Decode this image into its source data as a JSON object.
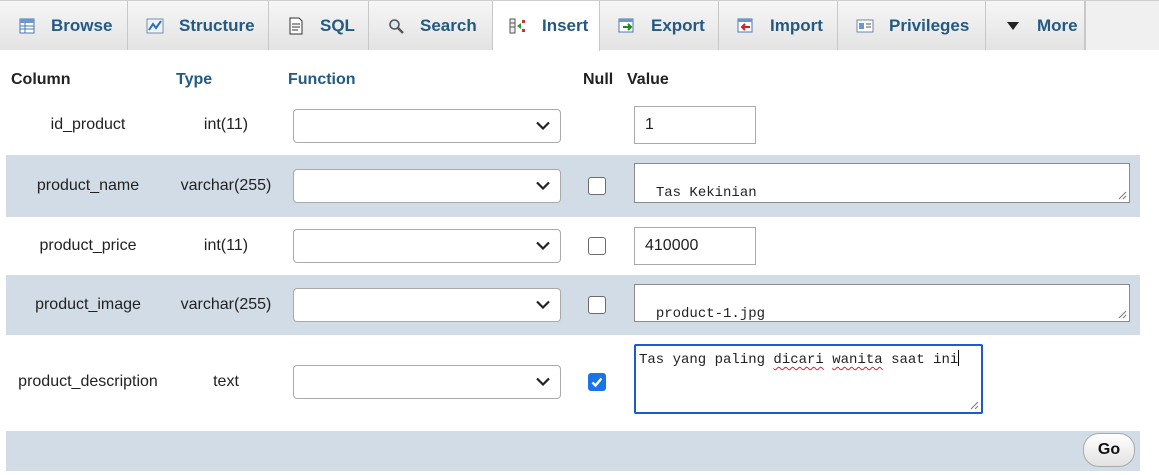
{
  "tabs": [
    {
      "label": "Browse",
      "icon": "table-icon"
    },
    {
      "label": "Structure",
      "icon": "structure-icon"
    },
    {
      "label": "SQL",
      "icon": "sql-icon"
    },
    {
      "label": "Search",
      "icon": "search-icon"
    },
    {
      "label": "Insert",
      "icon": "insert-icon",
      "active": true
    },
    {
      "label": "Export",
      "icon": "export-icon"
    },
    {
      "label": "Import",
      "icon": "import-icon"
    },
    {
      "label": "Privileges",
      "icon": "privileges-icon"
    },
    {
      "label": "More",
      "icon": "triangle-down-icon"
    }
  ],
  "columns": {
    "column": "Column",
    "type": "Type",
    "function": "Function",
    "null": "Null",
    "value": "Value"
  },
  "rows": [
    {
      "name": "id_product",
      "type": "int(11)",
      "function": "",
      "null_checkbox": false,
      "null_checked": false,
      "value": "1"
    },
    {
      "name": "product_name",
      "type": "varchar(255)",
      "function": "",
      "null_checkbox": true,
      "null_checked": false,
      "value": "Tas Kekinian"
    },
    {
      "name": "product_price",
      "type": "int(11)",
      "function": "",
      "null_checkbox": true,
      "null_checked": false,
      "value": "410000"
    },
    {
      "name": "product_image",
      "type": "varchar(255)",
      "function": "",
      "null_checkbox": true,
      "null_checked": false,
      "value": "product-1.jpg"
    },
    {
      "name": "product_description",
      "type": "text",
      "function": "",
      "null_checkbox": true,
      "null_checked": true,
      "value_parts": [
        "Tas yang paling ",
        "dicari",
        " ",
        "wanita",
        " saat ini"
      ]
    }
  ],
  "footer": {
    "go_label": "Go"
  },
  "colors": {
    "link": "#235a81",
    "row_shade": "#d2dce7",
    "checkbox_checked": "#1a74e8",
    "focus_border": "#1a5bd0"
  }
}
